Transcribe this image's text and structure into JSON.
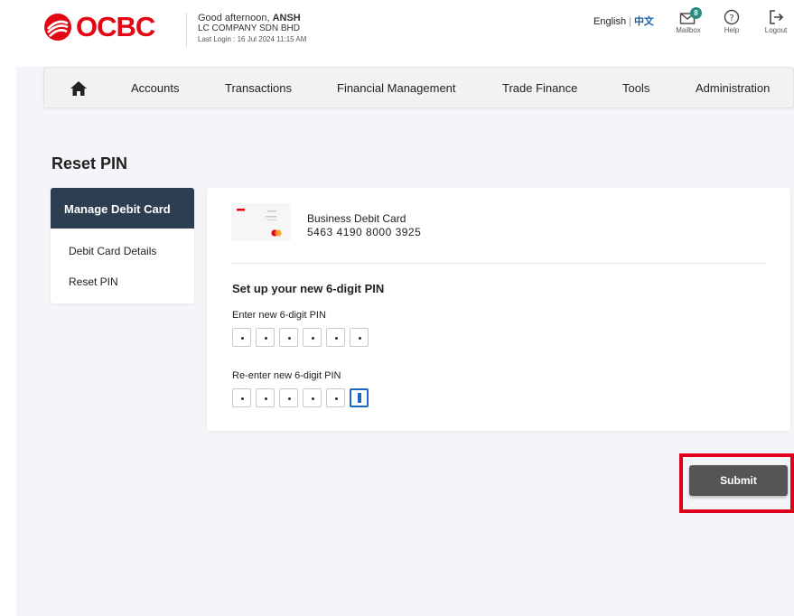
{
  "header": {
    "logo_text": "OCBC",
    "greeting_prefix": "Good afternoon, ",
    "user_name": "ANSH",
    "company": "LC COMPANY SDN BHD",
    "last_login": "Last Login : 16 Jul 2024 11:15 AM",
    "lang_en": "English",
    "lang_sep": "|",
    "lang_zh": "中文",
    "mailbox_label": "Mailbox",
    "mailbox_count": "8",
    "help_label": "Help",
    "logout_label": "Logout"
  },
  "nav": {
    "items": [
      "Accounts",
      "Transactions",
      "Financial Management",
      "Trade Finance",
      "Tools",
      "Administration"
    ]
  },
  "page": {
    "title": "Reset PIN"
  },
  "sidebar": {
    "heading": "Manage Debit Card",
    "items": [
      "Debit Card Details",
      "Reset PIN"
    ]
  },
  "card": {
    "name": "Business Debit Card",
    "number": "5463  4190  8000  3925"
  },
  "pin_form": {
    "title": "Set up your new 6-digit PIN",
    "new_pin_label": "Enter new 6-digit PIN",
    "reenter_pin_label": "Re-enter new 6-digit PIN"
  },
  "actions": {
    "submit_label": "Submit"
  },
  "colors": {
    "brand_red": "#e30613",
    "side_header": "#2c3e50",
    "submit": "#555556",
    "highlight": "#e0001b",
    "badge": "#2b8c82"
  }
}
